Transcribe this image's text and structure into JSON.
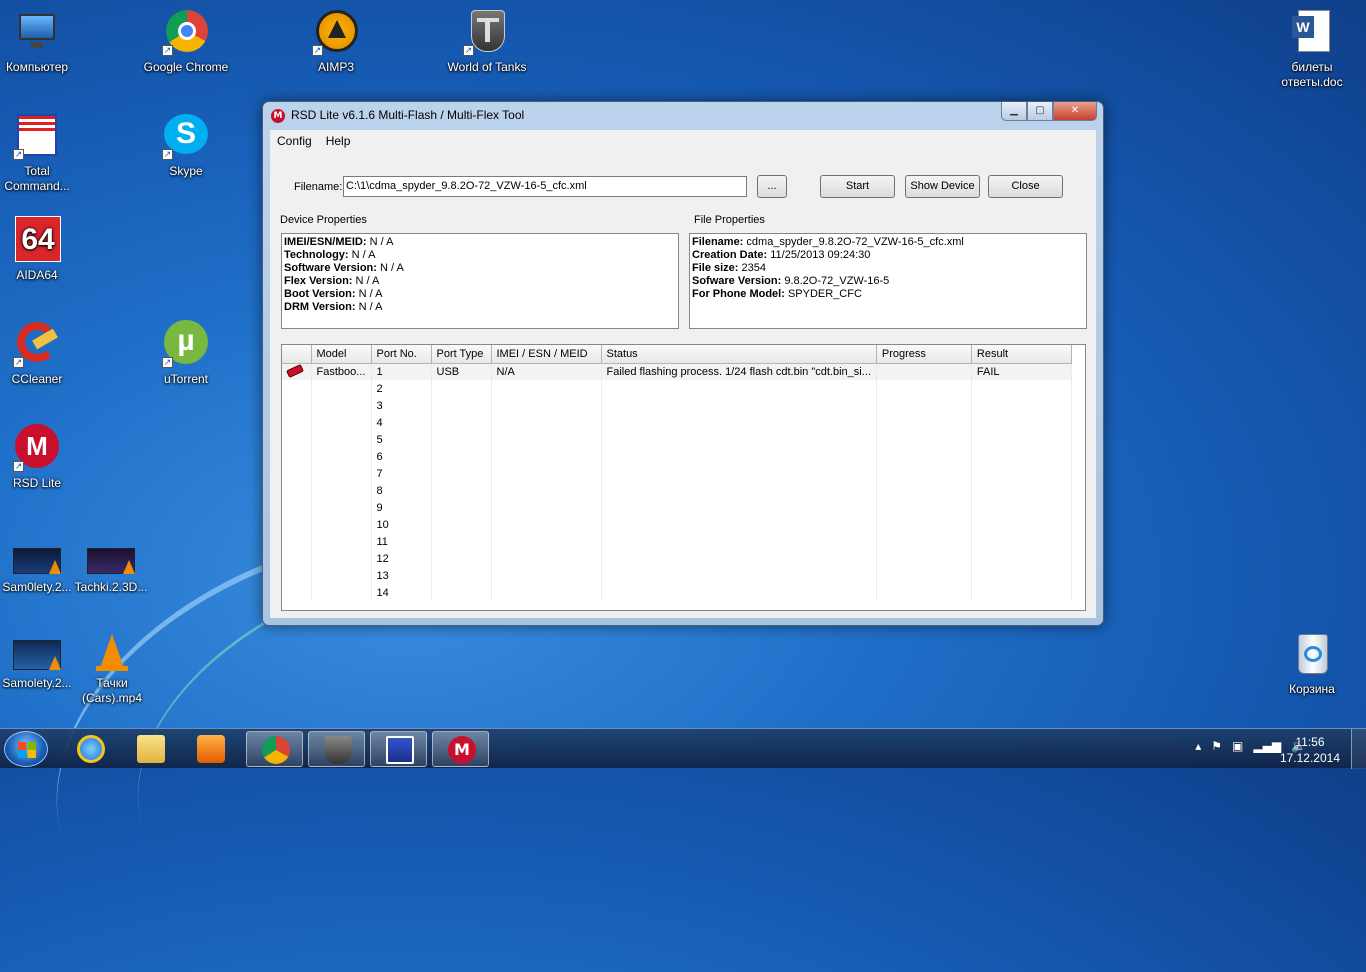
{
  "desktop": {
    "icons": [
      {
        "name": "Компьютер",
        "id": "computer"
      },
      {
        "name": "Google Chrome",
        "id": "chrome"
      },
      {
        "name": "AIMP3",
        "id": "aimp3"
      },
      {
        "name": "World of Tanks",
        "id": "wot"
      },
      {
        "name": "билеты ответы.doc",
        "id": "doc"
      },
      {
        "name": "Total Command...",
        "id": "totalcmd"
      },
      {
        "name": "Skype",
        "id": "skype"
      },
      {
        "name": "AIDA64",
        "id": "aida64"
      },
      {
        "name": "CCleaner",
        "id": "ccleaner"
      },
      {
        "name": "uTorrent",
        "id": "utorrent"
      },
      {
        "name": "RSD Lite",
        "id": "rsdlite"
      },
      {
        "name": "Sam0lety.2...",
        "id": "video1"
      },
      {
        "name": "Tachki.2.3D...",
        "id": "video2"
      },
      {
        "name": "Samolety.2...",
        "id": "video3"
      },
      {
        "name": "Тачки (Cars).mp4",
        "id": "vlcfile"
      },
      {
        "name": "Корзина",
        "id": "recycle"
      }
    ],
    "aida_text": "64",
    "skype_letter": "S"
  },
  "window": {
    "title": "RSD Lite v6.1.6 Multi-Flash / Multi-Flex Tool",
    "menu": [
      "Config",
      "Help"
    ],
    "filename_label": "Filename:",
    "filename_value": "C:\\1\\cdma_spyder_9.8.2O-72_VZW-16-5_cfc.xml",
    "browse_label": "...",
    "start_label": "Start",
    "show_device_label": "Show Device",
    "close_label": "Close",
    "device_properties_title": "Device Properties",
    "file_properties_title": "File Properties",
    "device_properties": [
      {
        "key": "IMEI/ESN/MEID:",
        "value": " N / A"
      },
      {
        "key": "Technology:",
        "value": " N / A"
      },
      {
        "key": "Software Version:",
        "value": " N / A"
      },
      {
        "key": "Flex Version:",
        "value": " N / A"
      },
      {
        "key": "Boot Version:",
        "value": " N / A"
      },
      {
        "key": "DRM Version:",
        "value": " N / A"
      }
    ],
    "file_properties": [
      {
        "key": "Filename:",
        "value": " cdma_spyder_9.8.2O-72_VZW-16-5_cfc.xml"
      },
      {
        "key": "Creation Date:",
        "value": " 11/25/2013 09:24:30"
      },
      {
        "key": "File size:",
        "value": " 2354"
      },
      {
        "key": "Sofware Version:",
        "value": " 9.8.2O-72_VZW-16-5"
      },
      {
        "key": "For Phone Model:",
        "value": " SPYDER_CFC"
      }
    ],
    "columns": [
      "",
      "Model",
      "Port No.",
      "Port Type",
      "IMEI / ESN / MEID",
      "Status",
      "Progress",
      "Result"
    ],
    "rows": [
      {
        "model": "Fastboo...",
        "port": "1",
        "type": "USB",
        "imei": "N/A",
        "status": "Failed flashing process. 1/24 flash cdt.bin \"cdt.bin_si...",
        "progress": "",
        "result": "FAIL"
      },
      {
        "model": "",
        "port": "2",
        "type": "",
        "imei": "",
        "status": "",
        "progress": "",
        "result": ""
      },
      {
        "model": "",
        "port": "3",
        "type": "",
        "imei": "",
        "status": "",
        "progress": "",
        "result": ""
      },
      {
        "model": "",
        "port": "4",
        "type": "",
        "imei": "",
        "status": "",
        "progress": "",
        "result": ""
      },
      {
        "model": "",
        "port": "5",
        "type": "",
        "imei": "",
        "status": "",
        "progress": "",
        "result": ""
      },
      {
        "model": "",
        "port": "6",
        "type": "",
        "imei": "",
        "status": "",
        "progress": "",
        "result": ""
      },
      {
        "model": "",
        "port": "7",
        "type": "",
        "imei": "",
        "status": "",
        "progress": "",
        "result": ""
      },
      {
        "model": "",
        "port": "8",
        "type": "",
        "imei": "",
        "status": "",
        "progress": "",
        "result": ""
      },
      {
        "model": "",
        "port": "9",
        "type": "",
        "imei": "",
        "status": "",
        "progress": "",
        "result": ""
      },
      {
        "model": "",
        "port": "10",
        "type": "",
        "imei": "",
        "status": "",
        "progress": "",
        "result": ""
      },
      {
        "model": "",
        "port": "11",
        "type": "",
        "imei": "",
        "status": "",
        "progress": "",
        "result": ""
      },
      {
        "model": "",
        "port": "12",
        "type": "",
        "imei": "",
        "status": "",
        "progress": "",
        "result": ""
      },
      {
        "model": "",
        "port": "13",
        "type": "",
        "imei": "",
        "status": "",
        "progress": "",
        "result": ""
      },
      {
        "model": "",
        "port": "14",
        "type": "",
        "imei": "",
        "status": "",
        "progress": "",
        "result": ""
      }
    ]
  },
  "taskbar": {
    "pinned": [
      "ie-icon",
      "explorer-icon",
      "media-player-icon",
      "chrome-icon",
      "world-of-tanks-icon",
      "total-commander-icon",
      "motorola-icon"
    ],
    "time": "11:56",
    "date": "17.12.2014"
  },
  "colors": {
    "motorola_red": "#c8102e",
    "desktop_blue": "#1f6fc8"
  }
}
